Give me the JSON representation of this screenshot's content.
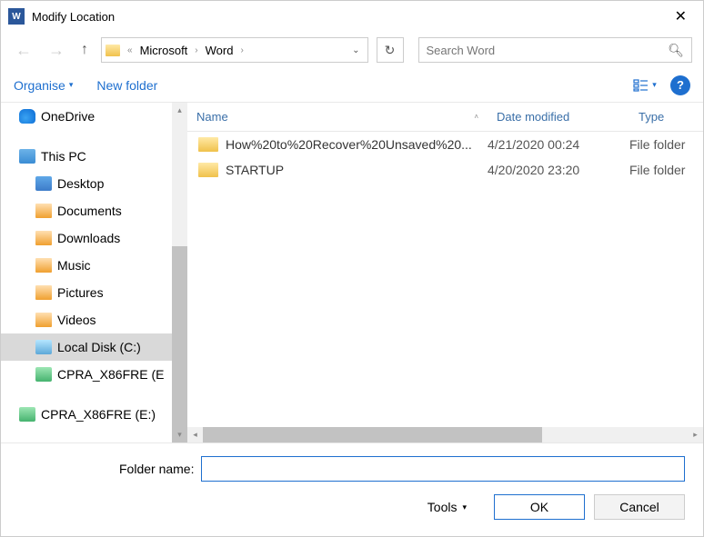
{
  "title": "Modify Location",
  "breadcrumbs": [
    {
      "prefix": "«",
      "items": [
        "Microsoft",
        "Word"
      ]
    }
  ],
  "crumb_prefix": "«",
  "crumb1": "Microsoft",
  "crumb2": "Word",
  "search_placeholder": "Search Word",
  "toolbar": {
    "organise": "Organise",
    "newfolder": "New folder"
  },
  "columns": {
    "name": "Name",
    "date": "Date modified",
    "type": "Type"
  },
  "tree": {
    "onedrive": "OneDrive",
    "thispc": "This PC",
    "desktop": "Desktop",
    "documents": "Documents",
    "downloads": "Downloads",
    "music": "Music",
    "pictures": "Pictures",
    "videos": "Videos",
    "localdisk": "Local Disk (C:)",
    "dvd1": "CPRA_X86FRE (E",
    "dvd2": "CPRA_X86FRE (E:)"
  },
  "files": [
    {
      "name": "How%20to%20Recover%20Unsaved%20...",
      "date": "4/21/2020 00:24",
      "type": "File folder"
    },
    {
      "name": "STARTUP",
      "date": "4/20/2020 23:20",
      "type": "File folder"
    }
  ],
  "folder_label": "Folder name:",
  "folder_value": "",
  "tools_label": "Tools",
  "ok": "OK",
  "cancel": "Cancel"
}
